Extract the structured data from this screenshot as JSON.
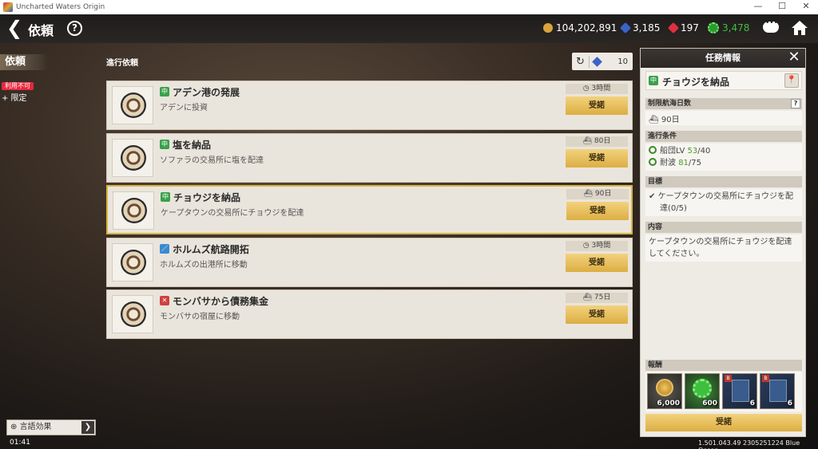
{
  "window": {
    "title": "Uncharted Waters Origin",
    "controls": [
      "—",
      "☐",
      "✕"
    ]
  },
  "header": {
    "title": "依頼",
    "help": "?"
  },
  "currencies": [
    {
      "name": "gold",
      "value": "104,202,891",
      "color": "#d9a43b"
    },
    {
      "name": "blue-gem",
      "value": "3,185",
      "color": "#3a64c9"
    },
    {
      "name": "red-gem",
      "value": "197",
      "color": "#e03040"
    },
    {
      "name": "green-gear",
      "value": "3,478",
      "color": "#3fbf3f"
    }
  ],
  "sidebar": {
    "tab": "依頼",
    "badge": "利用不可",
    "limit": "+ 限定"
  },
  "list": {
    "title": "進行依頼",
    "refresh_count": "10"
  },
  "requests": [
    {
      "tag": "#3aa04a",
      "tag_icon": "中",
      "title": "アデン港の発展",
      "desc": "アデンに投資",
      "cond_icon": "◷",
      "cond": "3時間",
      "accept": "受諾"
    },
    {
      "tag": "#3aa04a",
      "tag_icon": "中",
      "title": "塩を納品",
      "desc": "ソファラの交易所に塩を配達",
      "cond_icon": "⛴",
      "cond": "80日",
      "accept": "受諾"
    },
    {
      "tag": "#3aa04a",
      "tag_icon": "中",
      "title": "チョウジを納品",
      "desc": "ケープタウンの交易所にチョウジを配達",
      "cond_icon": "⛴",
      "cond": "90日",
      "accept": "受諾"
    },
    {
      "tag": "#3a8ad0",
      "tag_icon": "／",
      "title": "ホルムズ航路開拓",
      "desc": "ホルムズの出港所に移動",
      "cond_icon": "◷",
      "cond": "3時間",
      "accept": "受諾"
    },
    {
      "tag": "#d04040",
      "tag_icon": "✕",
      "title": "モンバサから債務集金",
      "desc": "モンバサの宿屋に移動",
      "cond_icon": "⛴",
      "cond": "75日",
      "accept": "受諾"
    }
  ],
  "panel": {
    "title": "任務情報",
    "task_tag": "中",
    "task": "チョウジを納品",
    "limit_label": "制限航海日数",
    "limit_help": "?",
    "limit_value": "90日",
    "cond_label": "進行条件",
    "cond1_label": "船団LV ",
    "cond1_cur": "53",
    "cond1_req": "/40",
    "cond2_label": "耐波 ",
    "cond2_cur": "81",
    "cond2_req": "/75",
    "goal_label": "目標",
    "goal_line1": "ケープタウンの交易所にチョウジを配",
    "goal_line2": "達(0/5)",
    "content_label": "内容",
    "content_line1": "ケープタウンの交易所にチョウジを配達",
    "content_line2": "してください。",
    "reward_label": "報酬",
    "rewards": [
      {
        "icon": "medal-icon",
        "qty": "6,000"
      },
      {
        "icon": "green-gear-icon",
        "qty": "600"
      },
      {
        "icon": "book-icon",
        "qty": "6"
      },
      {
        "icon": "book-icon",
        "qty": "6"
      }
    ],
    "accept": "受諾"
  },
  "footer": {
    "lang": "言語効果",
    "time": "01:41",
    "version": "1.501.043.49 2305251224 Blue Ocean"
  }
}
